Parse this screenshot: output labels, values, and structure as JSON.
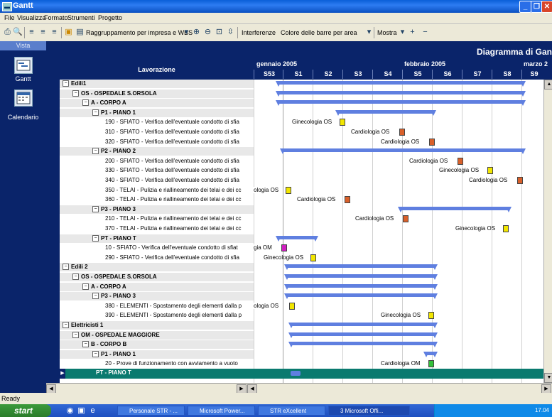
{
  "window": {
    "title": "Gantt"
  },
  "menu": [
    "File",
    "Visualizza",
    "Formato",
    "Strumenti",
    "Progetto"
  ],
  "toolbar": {
    "grouping": "Raggruppamento per impresa e WBS",
    "interference": "Interferenze",
    "bar_color": "Colore delle barre per area",
    "show": "Mostra"
  },
  "sidebar": {
    "header": "Vista",
    "items": [
      {
        "label": "Gantt",
        "icon": "gantt-icon"
      },
      {
        "label": "Calendario",
        "icon": "calendar-icon"
      }
    ]
  },
  "diagram_title": "Diagramma di Gan",
  "tree_header": "Lavorazione",
  "months": [
    {
      "label": "gennaio 2005"
    },
    {
      "label": "febbraio 2005"
    },
    {
      "label": "marzo 2"
    }
  ],
  "weeks": [
    "S53",
    "S1",
    "S2",
    "S3",
    "S4",
    "S5",
    "S6",
    "S7",
    "S8",
    "S9"
  ],
  "rows": [
    {
      "text": "Edili1",
      "level": 0,
      "group": true
    },
    {
      "text": "OS - OSPEDALE S.ORSOLA",
      "level": 1,
      "group": true
    },
    {
      "text": "A - CORPO A",
      "level": 2,
      "group": true
    },
    {
      "text": "P1 - PIANO 1",
      "level": 3,
      "group": true
    },
    {
      "text": "190 - SFIATO - Verifica dell'eventuale condotto di sfia",
      "level": 4,
      "label": "Ginecologia OS",
      "color": "#f2e600"
    },
    {
      "text": "310 - SFIATO - Verifica dell'eventuale condotto di sfia",
      "level": 4,
      "label": "Cardiologia OS",
      "color": "#d9602a"
    },
    {
      "text": "320 - SFIATO - Verifica dell'eventuale condotto di sfia",
      "level": 4,
      "label": "Cardiologia OS",
      "color": "#d9602a"
    },
    {
      "text": "P2 - PIANO 2",
      "level": 3,
      "group": true
    },
    {
      "text": "200 - SFIATO - Verifica dell'eventuale condotto di sfia",
      "level": 4,
      "label": "Cardiologia OS",
      "color": "#d9602a"
    },
    {
      "text": "330 - SFIATO - Verifica dell'eventuale condotto di sfia",
      "level": 4,
      "label": "Ginecologia OS",
      "color": "#f2e600"
    },
    {
      "text": "340 - SFIATO - Verifica dell'eventuale condotto di sfia",
      "level": 4,
      "label": "Cardiologia OS",
      "color": "#d9602a"
    },
    {
      "text": "350 - TELAI - Pulizia e riallineamento dei telai e dei cc",
      "level": 4,
      "label": "ologia OS",
      "color": "#f2e600"
    },
    {
      "text": "360 - TELAI - Pulizia e riallineamento dei telai e dei cc",
      "level": 4,
      "label": "Cardiologia OS",
      "color": "#d9602a"
    },
    {
      "text": "P3 - PIANO 3",
      "level": 3,
      "group": true
    },
    {
      "text": "210 - TELAI - Pulizia e riallineamento dei telai e dei cc",
      "level": 4,
      "label": "Cardiologia OS",
      "color": "#d9602a"
    },
    {
      "text": "370 - TELAI - Pulizia e riallineamento dei telai e dei cc",
      "level": 4,
      "label": "Ginecologia OS",
      "color": "#f2e600"
    },
    {
      "text": "PT - PIANO T",
      "level": 3,
      "group": true
    },
    {
      "text": "10 - SFIATO - Verifica dell'eventuale condotto di sfiat",
      "level": 4,
      "label": "gia OM",
      "color": "#d020c0"
    },
    {
      "text": "290 - SFIATO - Verifica dell'eventuale condotto di sfia",
      "level": 4,
      "label": "Ginecologia OS",
      "color": "#f2e600"
    },
    {
      "text": "Edili 2",
      "level": 0,
      "group": true
    },
    {
      "text": "OS - OSPEDALE S.ORSOLA",
      "level": 1,
      "group": true
    },
    {
      "text": "A - CORPO A",
      "level": 2,
      "group": true
    },
    {
      "text": "P3 - PIANO 3",
      "level": 3,
      "group": true
    },
    {
      "text": "380 - ELEMENTI - Spostamento degli elementi dalla p",
      "level": 4,
      "label": "ologia OS",
      "color": "#f2e600"
    },
    {
      "text": "390 - ELEMENTI - Spostamento degli elementi dalla p",
      "level": 4,
      "label": "Ginecologia OS",
      "color": "#f2e600"
    },
    {
      "text": "Elettricisti 1",
      "level": 0,
      "group": true
    },
    {
      "text": "OM - OSPEDALE MAGGIORE",
      "level": 1,
      "group": true
    },
    {
      "text": "B - CORPO B",
      "level": 2,
      "group": true
    },
    {
      "text": "P1 - PIANO 1",
      "level": 3,
      "group": true
    },
    {
      "text": "20 - Prove di funzionamento con avviamento a vuoto",
      "level": 4,
      "label": "Cardiologia OM",
      "color": "#33c03a"
    }
  ],
  "selected_row": {
    "text": "PT - PIANO T"
  },
  "status": "Ready",
  "taskbar": {
    "start": "start",
    "tasks": [
      "Personale STR - ...",
      "Microsoft Power...",
      "STR eXcellent",
      "3 Microsoft Offi..."
    ],
    "clock": "17.04"
  }
}
